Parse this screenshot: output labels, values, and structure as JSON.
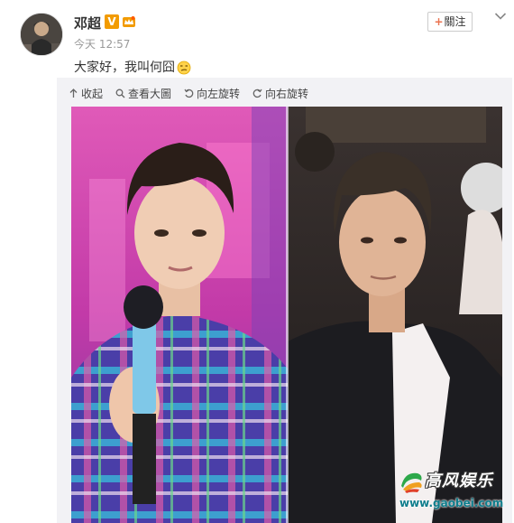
{
  "user": {
    "name": "邓超",
    "verified_badge": "V",
    "timestamp": "今天 12:57"
  },
  "post": {
    "text": "大家好，我叫何囧"
  },
  "actions": {
    "follow_plus": "+",
    "follow_label": "關注"
  },
  "media_toolbar": {
    "collapse": "收起",
    "view_large": "查看大圖",
    "rotate_left": "向左旋转",
    "rotate_right": "向右旋转"
  },
  "watermark": {
    "title": "高风娱乐",
    "url": "www.gaobei.com"
  },
  "icons": {
    "avatar": "avatar-photo",
    "verified": "verified-v-icon",
    "level": "member-crown-icon",
    "emoji": "smirk-emoji-icon",
    "collapse": "collapse-arrow-icon",
    "view_large": "magnifier-icon",
    "rotate_left": "rotate-left-icon",
    "rotate_right": "rotate-right-icon",
    "more": "chevron-down-icon"
  },
  "colors": {
    "accent": "#eb7350",
    "badge": "#f29b00",
    "muted": "#999999",
    "panel_bg": "#f2f2f5"
  }
}
